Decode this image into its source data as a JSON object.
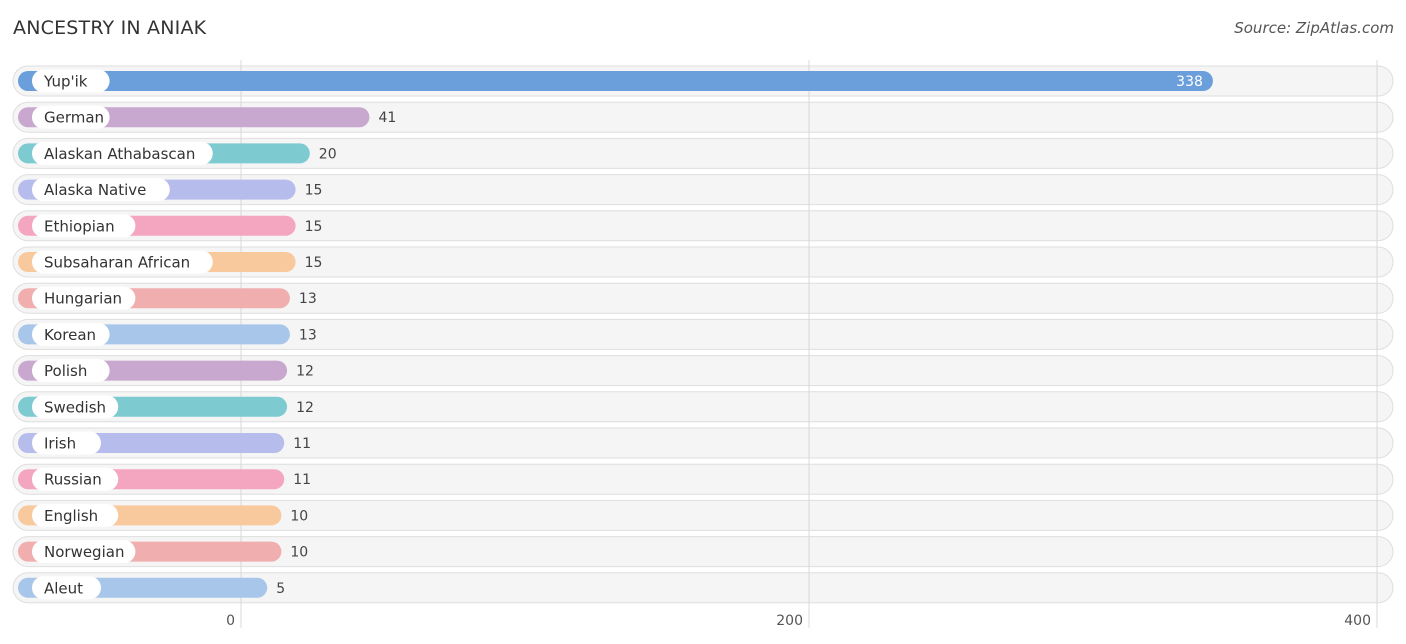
{
  "header": {
    "title": "ANCESTRY IN ANIAK",
    "source": "Source: ZipAtlas.com"
  },
  "chart_data": {
    "type": "bar",
    "orientation": "horizontal",
    "title": "ANCESTRY IN ANIAK",
    "xlabel": "",
    "ylabel": "",
    "xlim": [
      0,
      400
    ],
    "ticks": [
      0,
      200,
      400
    ],
    "grid": true,
    "categories": [
      "Yup'ik",
      "German",
      "Alaskan Athabascan",
      "Alaska Native",
      "Ethiopian",
      "Subsaharan African",
      "Hungarian",
      "Korean",
      "Polish",
      "Swedish",
      "Irish",
      "Russian",
      "English",
      "Norwegian",
      "Aleut"
    ],
    "values": [
      338,
      41,
      20,
      15,
      15,
      15,
      13,
      13,
      12,
      12,
      11,
      11,
      10,
      10,
      5
    ],
    "colors": [
      "#6a9fdc",
      "#c9a8d0",
      "#7ecad1",
      "#b6bdec",
      "#f4a6c1",
      "#f9c99e",
      "#f0aeae",
      "#a7c6ea",
      "#c9a8d0",
      "#7ecad1",
      "#b6bdec",
      "#f4a6c1",
      "#f9c99e",
      "#f0aeae",
      "#a7c6ea"
    ]
  }
}
